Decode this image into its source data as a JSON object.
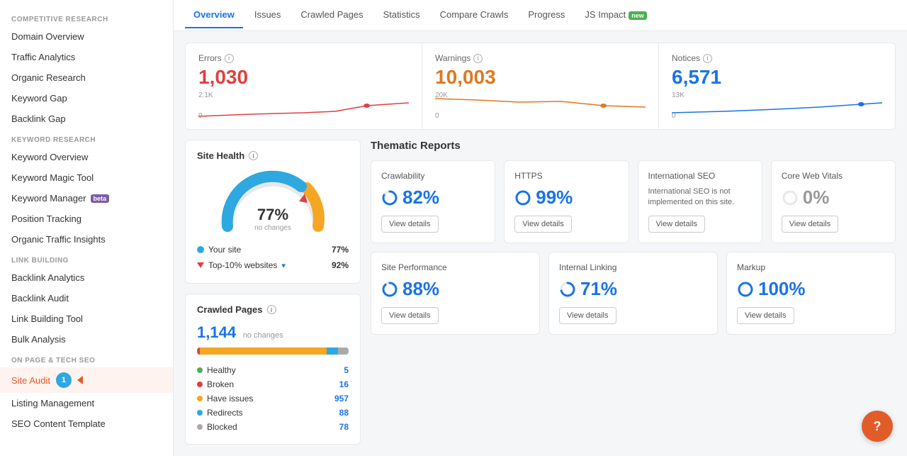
{
  "sidebar": {
    "sections": [
      {
        "label": "COMPETITIVE RESEARCH",
        "items": [
          {
            "id": "domain-overview",
            "text": "Domain Overview",
            "active": false
          },
          {
            "id": "traffic-analytics",
            "text": "Traffic Analytics",
            "active": false
          },
          {
            "id": "organic-research",
            "text": "Organic Research",
            "active": false
          },
          {
            "id": "keyword-gap",
            "text": "Keyword Gap",
            "active": false
          },
          {
            "id": "backlink-gap",
            "text": "Backlink Gap",
            "active": false
          }
        ]
      },
      {
        "label": "KEYWORD RESEARCH",
        "items": [
          {
            "id": "keyword-overview",
            "text": "Keyword Overview",
            "active": false
          },
          {
            "id": "keyword-magic-tool",
            "text": "Keyword Magic Tool",
            "active": false
          },
          {
            "id": "keyword-manager",
            "text": "Keyword Manager",
            "active": false,
            "badge": "beta"
          },
          {
            "id": "position-tracking",
            "text": "Position Tracking",
            "active": false
          },
          {
            "id": "organic-traffic-insights",
            "text": "Organic Traffic Insights",
            "active": false
          }
        ]
      },
      {
        "label": "LINK BUILDING",
        "items": [
          {
            "id": "backlink-analytics",
            "text": "Backlink Analytics",
            "active": false
          },
          {
            "id": "backlink-audit",
            "text": "Backlink Audit",
            "active": false
          },
          {
            "id": "link-building-tool",
            "text": "Link Building Tool",
            "active": false
          },
          {
            "id": "bulk-analysis",
            "text": "Bulk Analysis",
            "active": false
          }
        ]
      },
      {
        "label": "ON PAGE & TECH SEO",
        "items": [
          {
            "id": "site-audit",
            "text": "Site Audit",
            "active": true,
            "notification": "1"
          },
          {
            "id": "listing-management",
            "text": "Listing Management",
            "active": false
          },
          {
            "id": "seo-content-template",
            "text": "SEO Content Template",
            "active": false
          }
        ]
      }
    ]
  },
  "tabs": [
    {
      "id": "overview",
      "label": "Overview",
      "active": true
    },
    {
      "id": "issues",
      "label": "Issues",
      "active": false
    },
    {
      "id": "crawled-pages",
      "label": "Crawled Pages",
      "active": false
    },
    {
      "id": "statistics",
      "label": "Statistics",
      "active": false
    },
    {
      "id": "compare-crawls",
      "label": "Compare Crawls",
      "active": false
    },
    {
      "id": "progress",
      "label": "Progress",
      "active": false
    },
    {
      "id": "js-impact",
      "label": "JS Impact",
      "active": false,
      "badge": "new"
    }
  ],
  "metrics": {
    "errors": {
      "label": "Errors",
      "value": "1,030",
      "top_label": "2.1K",
      "bottom_label": "0",
      "color": "error"
    },
    "warnings": {
      "label": "Warnings",
      "value": "10,003",
      "top_label": "20K",
      "bottom_label": "0",
      "color": "warning"
    },
    "notices": {
      "label": "Notices",
      "value": "6,571",
      "top_label": "13K",
      "bottom_label": "0",
      "color": "notice"
    }
  },
  "site_health": {
    "title": "Site Health",
    "percent": "77%",
    "sub": "no changes",
    "your_site_label": "Your site",
    "your_site_val": "77%",
    "top_label": "Top-10% websites",
    "top_val": "92%"
  },
  "crawled_pages": {
    "title": "Crawled Pages",
    "count": "1,144",
    "no_changes": "no changes",
    "stats": [
      {
        "label": "Healthy",
        "value": "5",
        "color": "#4caf50"
      },
      {
        "label": "Broken",
        "value": "16",
        "color": "#e04040"
      },
      {
        "label": "Have issues",
        "value": "957",
        "color": "#f5a623"
      },
      {
        "label": "Redirects",
        "value": "88",
        "color": "#2ea8e0"
      },
      {
        "label": "Blocked",
        "value": "78",
        "color": "#aaa"
      }
    ]
  },
  "thematic_reports": {
    "title": "Thematic Reports",
    "row1": [
      {
        "id": "crawlability",
        "title": "Crawlability",
        "value": "82%",
        "type": "circle",
        "button": "View details"
      },
      {
        "id": "https",
        "title": "HTTPS",
        "value": "99%",
        "type": "circle",
        "button": "View details"
      },
      {
        "id": "international-seo",
        "title": "International SEO",
        "value": null,
        "type": "text",
        "description": "International SEO is not implemented on this site.",
        "button": "View details"
      },
      {
        "id": "core-web-vitals",
        "title": "Core Web Vitals",
        "value": "0%",
        "type": "circle-gray",
        "button": "View details"
      }
    ],
    "row2": [
      {
        "id": "site-performance",
        "title": "Site Performance",
        "value": "88%",
        "type": "circle",
        "button": "View details"
      },
      {
        "id": "internal-linking",
        "title": "Internal Linking",
        "value": "71%",
        "type": "circle",
        "button": "View details"
      },
      {
        "id": "markup",
        "title": "Markup",
        "value": "100%",
        "type": "circle",
        "button": "View details"
      }
    ]
  },
  "help_button": "?"
}
